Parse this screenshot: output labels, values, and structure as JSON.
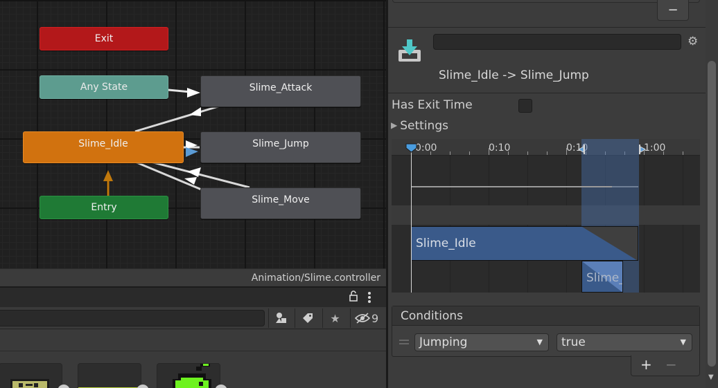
{
  "graph": {
    "nodes": {
      "exit": "Exit",
      "any_state": "Any State",
      "slime_attack": "Slime_Attack",
      "slime_idle": "Slime_Idle",
      "slime_jump": "Slime_Jump",
      "entry": "Entry",
      "slime_move": "Slime_Move"
    },
    "footer_path": "Animation/Slime.controller",
    "colors": {
      "exit": "#b3181a",
      "any_state": "#5d9c8f",
      "idle": "#d1720f",
      "entry": "#1f7a35",
      "state": "#4f5055",
      "selected_transition": "#5b9bd5"
    }
  },
  "project": {
    "search_placeholder": "",
    "hidden_count": "9",
    "icons": [
      "lock-icon",
      "more-icon",
      "filter-type-icon",
      "label-icon",
      "star-icon",
      "visibility-off-icon"
    ]
  },
  "inspector": {
    "transition_name_value": "",
    "transition_title": "Slime_Idle -> Slime_Jump",
    "has_exit_time_label": "Has Exit Time",
    "has_exit_time_checked": false,
    "settings_label": "Settings",
    "timeline": {
      "labels": [
        "0:00",
        "0:10",
        "0:10",
        "1:00"
      ],
      "clip_from": "Slime_Idle",
      "clip_to": "Slime_"
    },
    "conditions": {
      "header": "Conditions",
      "parameter": "Jumping",
      "value": "true",
      "add_label": "+",
      "remove_label": "−"
    },
    "top_remove_label": "−"
  }
}
